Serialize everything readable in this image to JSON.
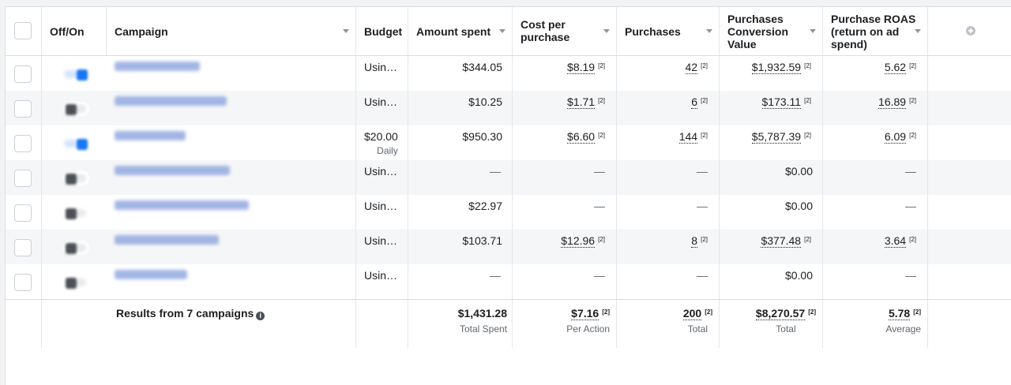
{
  "header": {
    "off_on": "Off/On",
    "campaign": "Campaign",
    "budget": "Budget",
    "amount_spent": "Amount spent",
    "cost_per_purchase_1": "Cost per",
    "cost_per_purchase_2": "purchase",
    "purchases": "Purchases",
    "pcv_1": "Purchases",
    "pcv_2": "Conversion",
    "pcv_3": "Value",
    "roas_1": "Purchase ROAS",
    "roas_2": "(return on ad",
    "roas_3": "spend)",
    "add_column_icon": "plus-circle-icon"
  },
  "rows": [
    {
      "toggle": "on",
      "name_width": 108,
      "budget": "Usin…",
      "budget_sub": "",
      "spent": "$344.05",
      "cpp": "$8.19",
      "cpp_sup": "[2]",
      "purchases": "42",
      "purchases_sup": "[2]",
      "pcv": "$1,932.59",
      "pcv_sup": "[2]",
      "roas": "5.62",
      "roas_sup": "[2]"
    },
    {
      "toggle": "off",
      "name_width": 142,
      "budget": "Usin…",
      "budget_sub": "",
      "spent": "$10.25",
      "cpp": "$1.71",
      "cpp_sup": "[2]",
      "purchases": "6",
      "purchases_sup": "[2]",
      "pcv": "$173.11",
      "pcv_sup": "[2]",
      "roas": "16.89",
      "roas_sup": "[2]"
    },
    {
      "toggle": "on",
      "name_width": 90,
      "budget": "$20.00",
      "budget_sub": "Daily",
      "spent": "$950.30",
      "cpp": "$6.60",
      "cpp_sup": "[2]",
      "purchases": "144",
      "purchases_sup": "[2]",
      "pcv": "$5,787.39",
      "pcv_sup": "[2]",
      "roas": "6.09",
      "roas_sup": "[2]"
    },
    {
      "toggle": "off",
      "name_width": 146,
      "budget": "Usin…",
      "budget_sub": "",
      "spent": "—",
      "cpp": "—",
      "cpp_sup": "",
      "purchases": "—",
      "purchases_sup": "",
      "pcv": "$0.00",
      "pcv_sup": "",
      "roas": "—",
      "roas_sup": ""
    },
    {
      "toggle": "off",
      "name_width": 170,
      "budget": "Usin…",
      "budget_sub": "",
      "spent": "$22.97",
      "cpp": "—",
      "cpp_sup": "",
      "purchases": "—",
      "purchases_sup": "",
      "pcv": "$0.00",
      "pcv_sup": "",
      "roas": "—",
      "roas_sup": ""
    },
    {
      "toggle": "off",
      "name_width": 132,
      "budget": "Usin…",
      "budget_sub": "",
      "spent": "$103.71",
      "cpp": "$12.96",
      "cpp_sup": "[2]",
      "purchases": "8",
      "purchases_sup": "[2]",
      "pcv": "$377.48",
      "pcv_sup": "[2]",
      "roas": "3.64",
      "roas_sup": "[2]"
    },
    {
      "toggle": "off",
      "name_width": 92,
      "budget": "Usin…",
      "budget_sub": "",
      "spent": "—",
      "cpp": "—",
      "cpp_sup": "",
      "purchases": "—",
      "purchases_sup": "",
      "pcv": "$0.00",
      "pcv_sup": "",
      "roas": "—",
      "roas_sup": ""
    }
  ],
  "footer": {
    "results": "Results from 7 campaigns",
    "info_icon": "i",
    "spent": "$1,431.28",
    "spent_label": "Total Spent",
    "cpp": "$7.16",
    "cpp_sup": "[2]",
    "cpp_label": "Per Action",
    "purchases": "200",
    "purchases_sup": "[2]",
    "purchases_label": "Total",
    "pcv": "$8,270.57",
    "pcv_sup": "[2]",
    "pcv_label": "Total",
    "roas": "5.78",
    "roas_sup": "[2]",
    "roas_label": "Average"
  },
  "colors": {
    "toggle_on": "#1877f2",
    "toggle_off": "#4b4f56",
    "border": "#dadde1",
    "alt_row": "#f5f6f7"
  }
}
